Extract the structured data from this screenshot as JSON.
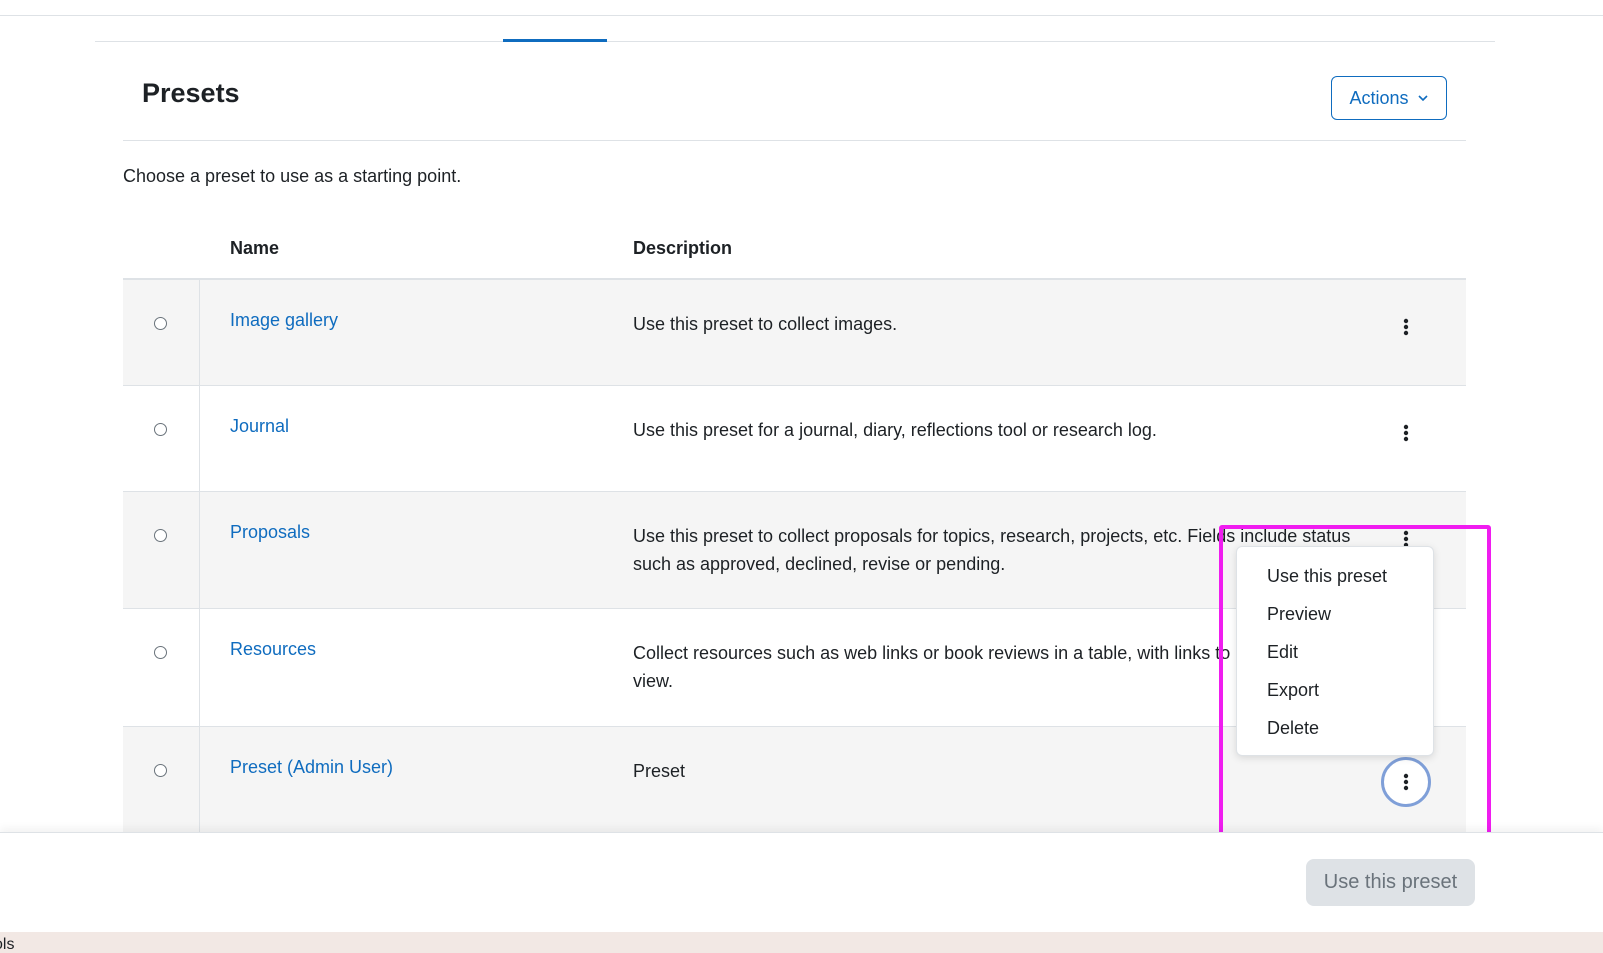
{
  "header": {
    "title": "Presets",
    "actions_label": "Actions",
    "intro": "Choose a preset to use as a starting point."
  },
  "table": {
    "columns": {
      "name": "Name",
      "description": "Description"
    },
    "rows": [
      {
        "name": "Image gallery",
        "description": "Use this preset to collect images."
      },
      {
        "name": "Journal",
        "description": "Use this preset for a journal, diary, reflections tool or research log."
      },
      {
        "name": "Proposals",
        "description": "Use this preset to collect proposals for topics, research, projects, etc. Fields include status such as approved, declined, revise or pending."
      },
      {
        "name": "Resources",
        "description": "Collect resources such as web links or book reviews in a table, with links to a detailed view."
      },
      {
        "name": "Preset (Admin User)",
        "description": "Preset"
      }
    ]
  },
  "context_menu": {
    "items": [
      "Use this preset",
      "Preview",
      "Edit",
      "Export",
      "Delete"
    ]
  },
  "footer": {
    "use_preset_label": "Use this preset"
  },
  "bottom_strip": {
    "text": "ols"
  },
  "colors": {
    "accent": "#0f6cbf",
    "highlight": "#f01cf0",
    "focus_ring": "#7f9fd8",
    "row_alt": "#f5f5f5"
  },
  "icons": {
    "kebab": "kebab-icon",
    "chevron": "chevron-down-icon"
  }
}
